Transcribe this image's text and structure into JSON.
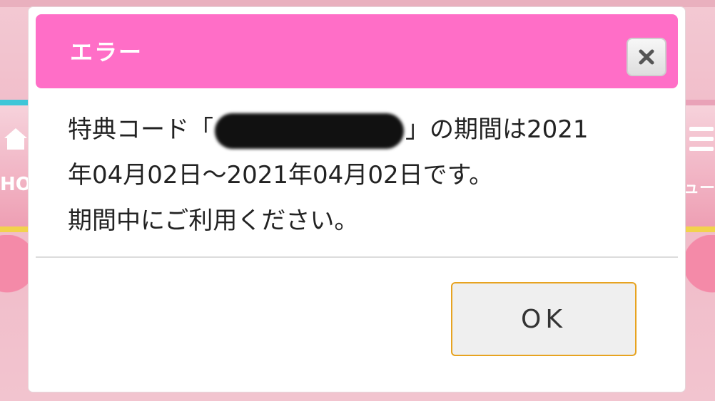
{
  "dialog": {
    "title": "エラー",
    "close_icon": "close-icon",
    "message_line1_prefix": "特典コード「",
    "message_line1_suffix": "」の期間は2021",
    "message_line2": "年04月02日～2021年04月02日です。",
    "message_line3": "期間中にご利用ください。",
    "ok_label": "OK"
  },
  "colors": {
    "header": "#ff6ec7",
    "ok_border": "#e7a320",
    "background": "#f0b8c6"
  }
}
